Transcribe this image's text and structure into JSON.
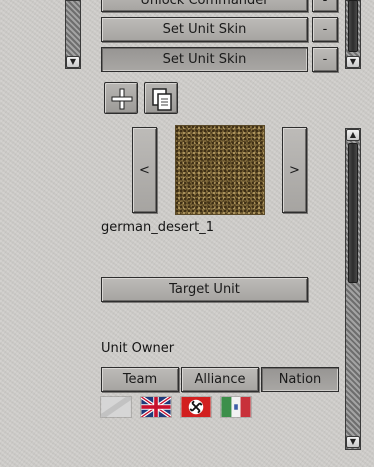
{
  "commander_list": {
    "rows": [
      {
        "label": "Unlock Commander",
        "remove_label": "-"
      },
      {
        "label": "Set Unit Skin",
        "remove_label": "-"
      },
      {
        "label": "Set Unit Skin",
        "remove_label": "-"
      }
    ]
  },
  "toolbar": {
    "add_icon": "plus-icon",
    "copy_icon": "copy-icon"
  },
  "skin_selector": {
    "prev_label": "<",
    "next_label": ">",
    "skin_name": "german_desert_1"
  },
  "target_unit_label": "Target Unit",
  "unit_owner": {
    "heading": "Unit Owner",
    "tabs": [
      "Team",
      "Alliance",
      "Nation"
    ],
    "selected_tab": "Nation",
    "flags": [
      "blank-flag",
      "united-kingdom-flag",
      "germany-flag",
      "italy-flag"
    ]
  },
  "scrollbar": {
    "up_arrow": "▲",
    "down_arrow": "▼"
  }
}
